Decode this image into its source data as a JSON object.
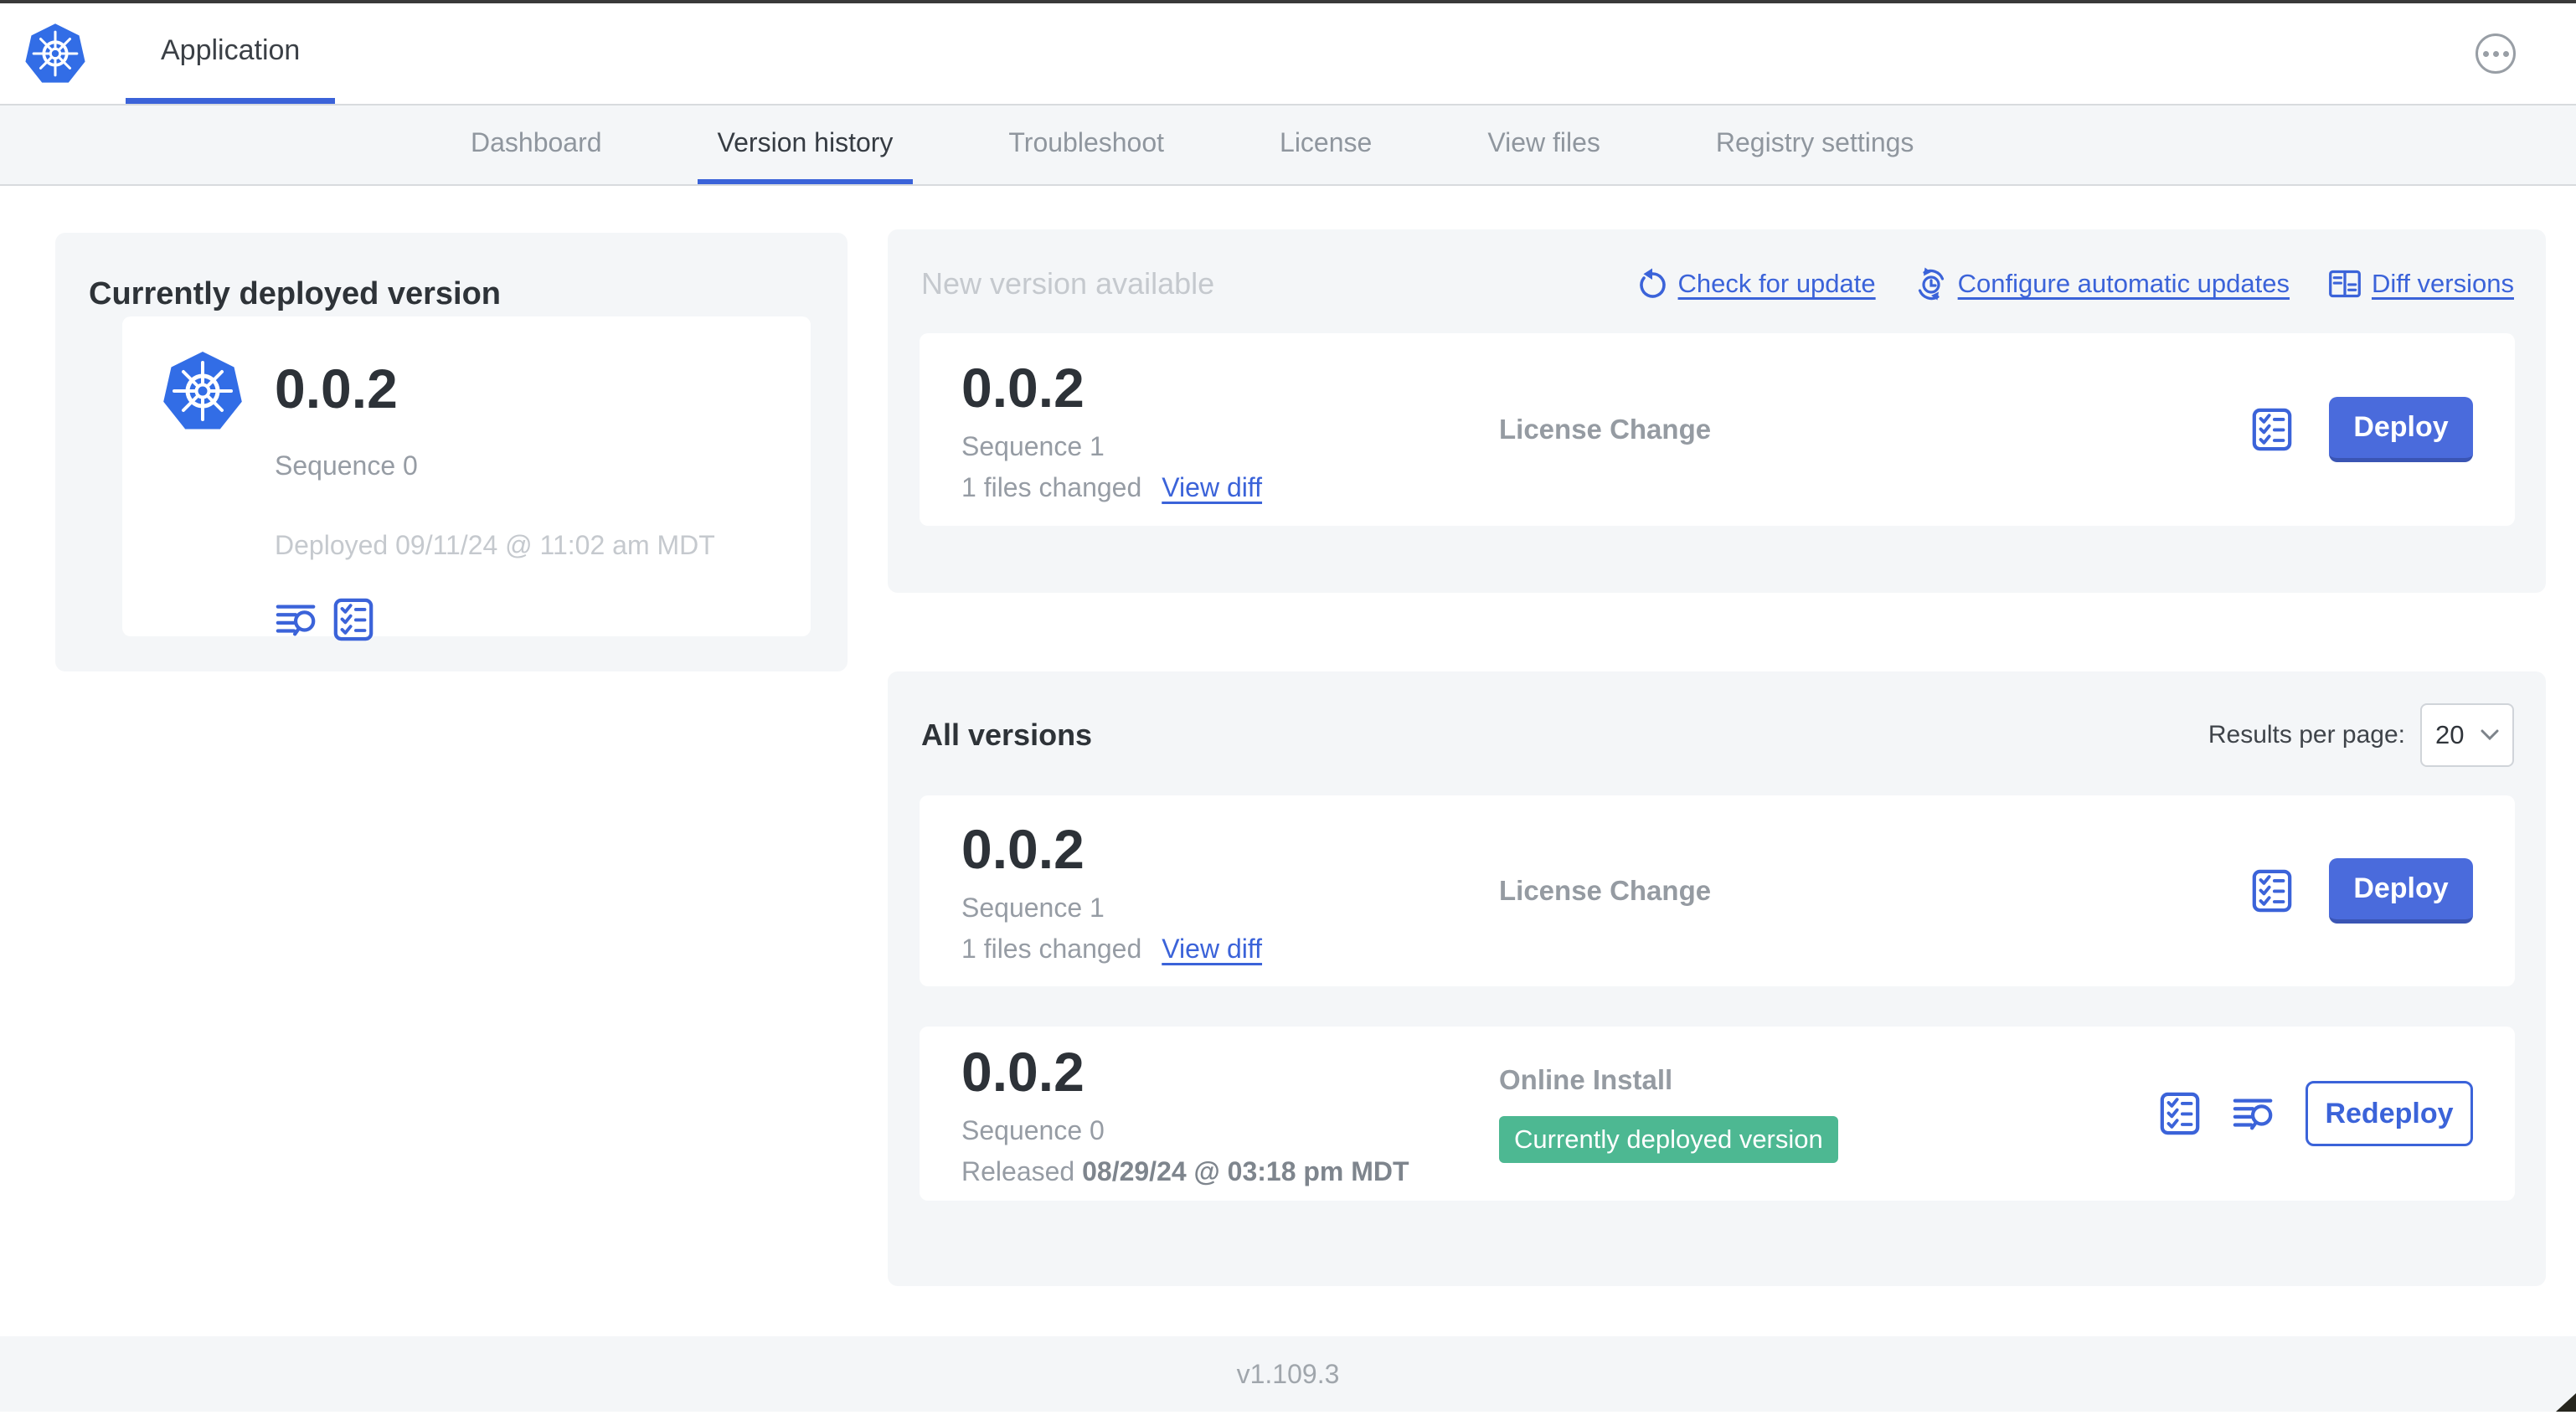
{
  "colors": {
    "brand_blue": "#326de6",
    "link_blue": "#3b63d9",
    "button_blue": "#4a6bdc",
    "badge_green": "#4db892",
    "muted_text": "#969ca4",
    "faint_text": "#c5c9ce",
    "section_bg": "#f4f6f8"
  },
  "icons": {
    "logo": "kubernetes-logo",
    "menu": "ellipsis-icon",
    "check_update": "refresh-arrow-icon",
    "auto_updates": "clock-sync-icon",
    "diff": "diff-columns-icon",
    "logs": "lines-magnifier-icon",
    "checklist": "checklist-icon",
    "chevron": "chevron-down-icon"
  },
  "header": {
    "app_title": "Application"
  },
  "nav": {
    "tabs": [
      {
        "label": "Dashboard",
        "active": false
      },
      {
        "label": "Version history",
        "active": true
      },
      {
        "label": "Troubleshoot",
        "active": false
      },
      {
        "label": "License",
        "active": false
      },
      {
        "label": "View files",
        "active": false
      },
      {
        "label": "Registry settings",
        "active": false
      }
    ]
  },
  "current_version_card": {
    "title": "Currently deployed version",
    "version": "0.0.2",
    "sequence": "Sequence 0",
    "deployed": "Deployed 09/11/24 @ 11:02 am MDT"
  },
  "new_version_section": {
    "title": "New version available",
    "check_for_update": "Check for update",
    "configure_automatic_updates": "Configure automatic updates",
    "diff_versions": "Diff versions",
    "card": {
      "version": "0.0.2",
      "sequence": "Sequence 1",
      "files_changed": "1 files changed",
      "view_diff": "View diff",
      "source": "License Change",
      "action_label": "Deploy"
    }
  },
  "all_versions_section": {
    "title": "All versions",
    "results_per_page_label": "Results per page:",
    "results_per_page_value": "20",
    "rows": [
      {
        "version": "0.0.2",
        "sequence": "Sequence 1",
        "files_changed": "1 files changed",
        "view_diff": "View diff",
        "source": "License Change",
        "action_label": "Deploy"
      },
      {
        "version": "0.0.2",
        "sequence": "Sequence 0",
        "released_prefix": "Released",
        "released_date": "08/29/24 @ 03:18 pm MDT",
        "source": "Online Install",
        "badge": "Currently deployed version",
        "action_label": "Redeploy"
      }
    ]
  },
  "footer": {
    "app_manager_version": "v1.109.3"
  }
}
